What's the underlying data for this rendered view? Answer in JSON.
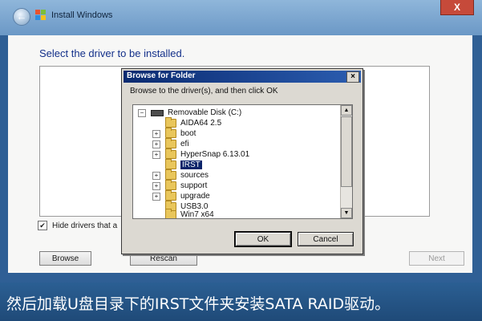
{
  "window": {
    "title": "Install Windows",
    "close_symbol": "X",
    "back_symbol": "←"
  },
  "wizard": {
    "heading": "Select the driver to be installed.",
    "hide_checkbox": {
      "checked": true,
      "mark": "✔",
      "label": "Hide drivers that a"
    },
    "buttons": {
      "browse": "Browse",
      "rescan": "Rescan",
      "next": "Next"
    }
  },
  "dialog": {
    "title": "Browse for Folder",
    "close_symbol": "×",
    "prompt": "Browse to the driver(s), and then click OK",
    "tree": {
      "root": {
        "label": "Removable Disk (C:)",
        "toggle": "−"
      },
      "items": [
        {
          "label": "AIDA64 2.5",
          "toggle": ""
        },
        {
          "label": "boot",
          "toggle": "+"
        },
        {
          "label": "efi",
          "toggle": "+"
        },
        {
          "label": "HyperSnap 6.13.01",
          "toggle": "+"
        },
        {
          "label": "IRST",
          "toggle": "",
          "selected": true
        },
        {
          "label": "sources",
          "toggle": "+"
        },
        {
          "label": "support",
          "toggle": "+"
        },
        {
          "label": "upgrade",
          "toggle": "+"
        },
        {
          "label": "USB3.0",
          "toggle": ""
        },
        {
          "label": "Win7 x64",
          "toggle": ""
        }
      ],
      "scroll_up": "▲",
      "scroll_down": "▼"
    },
    "buttons": {
      "ok": "OK",
      "cancel": "Cancel"
    }
  },
  "caption": "然后加载U盘目录下的IRST文件夹安装SATA RAID驱动。"
}
